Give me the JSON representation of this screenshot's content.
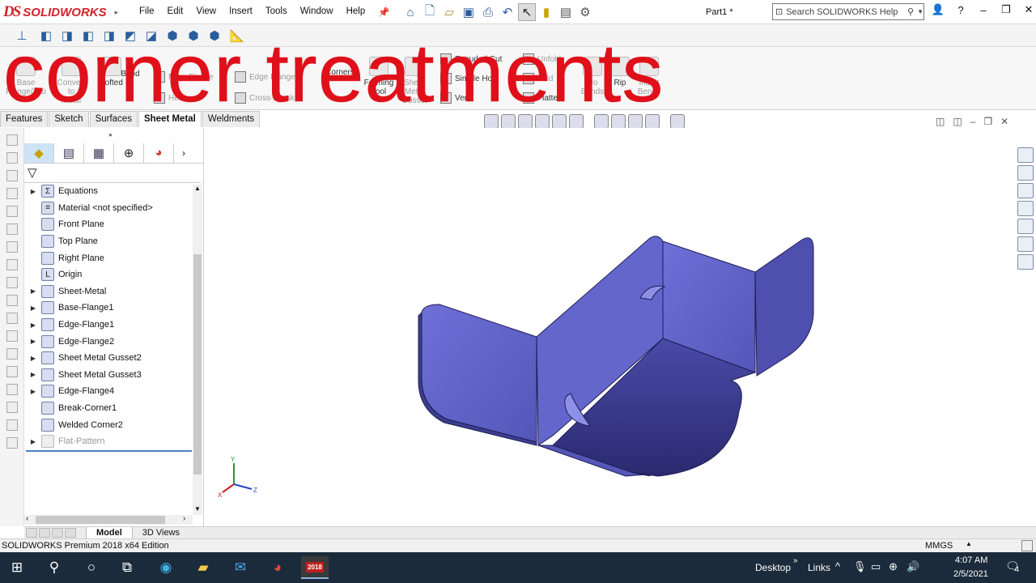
{
  "app": {
    "logo_mark": "DS",
    "logo_word": "SOLIDWORKS",
    "doc_title": "Part1 *"
  },
  "menu": [
    "File",
    "Edit",
    "View",
    "Insert",
    "Tools",
    "Window",
    "Help"
  ],
  "search": {
    "placeholder": "Search SOLIDWORKS Help"
  },
  "overlay_text": "corner treatments",
  "ribbon": {
    "base_flange": "Base\nFlange/Tab",
    "convert": "Convert\nto\nMetal",
    "lofted": "Lofted",
    "bend": "Bend",
    "miter_flange": "Miter Flange",
    "hem": "Hem",
    "edge_flange": "Edge Flange",
    "cross_break": "Cross-Break",
    "corners": "Corners",
    "forming_tool": "Forming\nTool",
    "sheet_metal_gusset": "Sheet\nMetal\nGusset",
    "extruded_cut": "Extruded Cut",
    "simple_hole": "Simple Hole",
    "vent": "Vent",
    "unfold": "Unfold",
    "fold": "Fold",
    "flatten": "Flatten",
    "no_bends": "No\nBends",
    "rip": "Rip",
    "insert_bends": "Insert\nBends"
  },
  "tabs": [
    {
      "label": "Features",
      "active": false
    },
    {
      "label": "Sketch",
      "active": false
    },
    {
      "label": "Surfaces",
      "active": false
    },
    {
      "label": "Sheet Metal",
      "active": true
    },
    {
      "label": "Weldments",
      "active": false
    }
  ],
  "tree": [
    {
      "label": "Equations",
      "expand": true,
      "icon": "sigma-icon",
      "glyph": "Σ",
      "dim": false
    },
    {
      "label": "Material <not specified>",
      "expand": false,
      "icon": "material-icon",
      "glyph": "≡",
      "dim": false
    },
    {
      "label": "Front Plane",
      "expand": false,
      "icon": "plane-icon",
      "glyph": "",
      "dim": false
    },
    {
      "label": "Top Plane",
      "expand": false,
      "icon": "plane-icon",
      "glyph": "",
      "dim": false
    },
    {
      "label": "Right Plane",
      "expand": false,
      "icon": "plane-icon",
      "glyph": "",
      "dim": false
    },
    {
      "label": "Origin",
      "expand": false,
      "icon": "origin-icon",
      "glyph": "L",
      "dim": false
    },
    {
      "label": "Sheet-Metal",
      "expand": true,
      "icon": "sheet-metal-icon",
      "glyph": "",
      "dim": false
    },
    {
      "label": "Base-Flange1",
      "expand": true,
      "icon": "base-flange-icon",
      "glyph": "",
      "dim": false
    },
    {
      "label": "Edge-Flange1",
      "expand": true,
      "icon": "edge-flange-icon",
      "glyph": "",
      "dim": false
    },
    {
      "label": "Edge-Flange2",
      "expand": true,
      "icon": "edge-flange-icon",
      "glyph": "",
      "dim": false
    },
    {
      "label": "Sheet Metal Gusset2",
      "expand": true,
      "icon": "gusset-icon",
      "glyph": "",
      "dim": false
    },
    {
      "label": "Sheet Metal Gusset3",
      "expand": true,
      "icon": "gusset-icon",
      "glyph": "",
      "dim": false
    },
    {
      "label": "Edge-Flange4",
      "expand": true,
      "icon": "edge-flange-icon",
      "glyph": "",
      "dim": false
    },
    {
      "label": "Break-Corner1",
      "expand": false,
      "icon": "break-corner-icon",
      "glyph": "",
      "dim": false
    },
    {
      "label": "Welded Corner2",
      "expand": false,
      "icon": "welded-corner-icon",
      "glyph": "",
      "dim": false
    },
    {
      "label": "Flat-Pattern",
      "expand": true,
      "icon": "flat-pattern-icon",
      "glyph": "",
      "dim": true
    }
  ],
  "bottom_tabs": [
    "Model",
    "3D Views"
  ],
  "status": {
    "left": "SOLIDWORKS Premium 2018 x64 Edition",
    "units": "MMGS"
  },
  "taskbar": {
    "sw_badge": "2018",
    "desktop": "Desktop",
    "links": "Links",
    "time": "4:07 AM",
    "date": "2/5/2021",
    "notif_count": "4"
  },
  "triad": {
    "x": "X",
    "y": "Y",
    "z": "Z"
  }
}
